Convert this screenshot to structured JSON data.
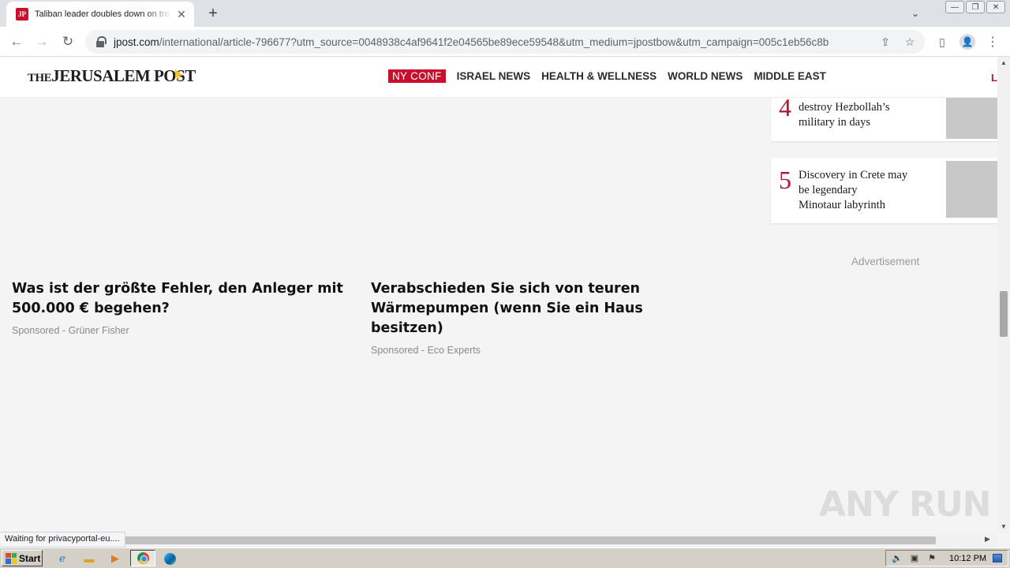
{
  "browser": {
    "tab": {
      "title": "Taliban leader doubles down on treatment of women",
      "favicon_text": "JP"
    },
    "url_host": "jpost.com",
    "url_path": "/international/article-796677?utm_source=0048938c4af9641f2e04565be89ece59548&utm_medium=jpostbow&utm_campaign=005c1eb56c8b",
    "icons": {
      "close": "✕",
      "new_tab": "+",
      "tab_search": "⌄",
      "back": "←",
      "forward": "→",
      "reload": "↻",
      "share": "⇪",
      "bookmark": "☆",
      "side_panel": "▯",
      "profile": "👤",
      "menu": "⋮",
      "minimize": "—",
      "restore": "❐",
      "window_close": "✕"
    }
  },
  "site": {
    "logo": {
      "the": "THE",
      "name": "JERUSALEM POST"
    },
    "nav": [
      {
        "label": "NY CONF",
        "badge": true
      },
      {
        "label": "ISRAEL NEWS"
      },
      {
        "label": "HEALTH & WELLNESS"
      },
      {
        "label": "WORLD NEWS"
      },
      {
        "label": "MIDDLE EAST"
      }
    ],
    "nav_cut_off": "L"
  },
  "promos": [
    {
      "title": "Was ist der größte Fehler, den Anleger mit 500.000 € begehen?",
      "sponsor": "Sponsored - Grüner Fisher"
    },
    {
      "title": "Verabschieden Sie sich von teuren Wärmepumpen (wenn Sie ein Haus besitzen)",
      "sponsor": "Sponsored - Eco Experts"
    }
  ],
  "most_read": [
    {
      "rank": "4",
      "lines": [
        "destroy Hezbollah’s",
        "military in days"
      ]
    },
    {
      "rank": "5",
      "lines": [
        "Discovery in Crete may",
        "be legendary",
        "Minotaur labyrinth"
      ]
    }
  ],
  "advertisement_label": "Advertisement",
  "status_bar": "Waiting for privacyportal-eu....",
  "watermark": "ANY RUN",
  "taskbar": {
    "start_label": "Start",
    "clock": "10:12 PM",
    "flag_colors": [
      "#e8462a",
      "#3cae3c",
      "#2a6fd8",
      "#f2c51a"
    ]
  }
}
